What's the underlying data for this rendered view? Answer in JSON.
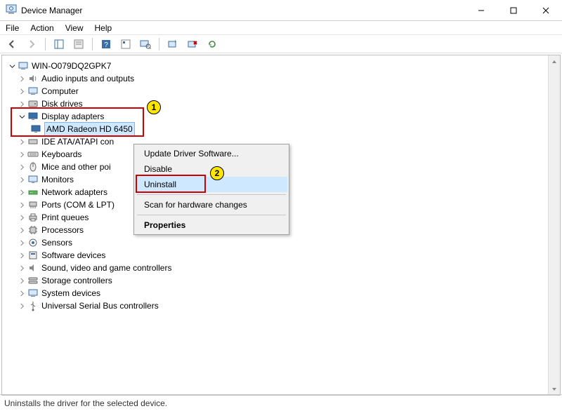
{
  "window": {
    "title": "Device Manager"
  },
  "menus": {
    "file": "File",
    "action": "Action",
    "view": "View",
    "help": "Help"
  },
  "tree": {
    "root": "WIN-O079DQ2GPK7",
    "items": [
      "Audio inputs and outputs",
      "Computer",
      "Disk drives",
      "Display adapters",
      "IDE ATA/ATAPI con",
      "Keyboards",
      "Mice and other poi",
      "Monitors",
      "Network adapters",
      "Ports (COM & LPT)",
      "Print queues",
      "Processors",
      "Sensors",
      "Software devices",
      "Sound, video and game controllers",
      "Storage controllers",
      "System devices",
      "Universal Serial Bus controllers"
    ],
    "displayChild": "AMD Radeon HD 6450"
  },
  "context": {
    "update": "Update Driver Software...",
    "disable": "Disable",
    "uninstall": "Uninstall",
    "scan": "Scan for hardware changes",
    "properties": "Properties"
  },
  "annotations": {
    "one": "1",
    "two": "2"
  },
  "status": "Uninstalls the driver for the selected device."
}
